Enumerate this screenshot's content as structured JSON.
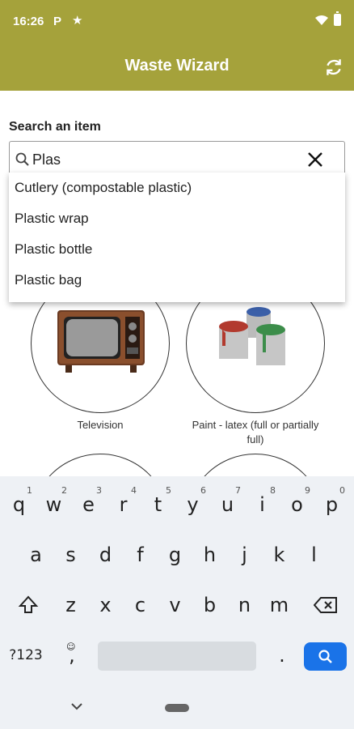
{
  "status_bar": {
    "time": "16:26",
    "notif_app": "P"
  },
  "app_bar": {
    "title": "Waste Wizard"
  },
  "search": {
    "label": "Search an item",
    "value": "Plas"
  },
  "suggestions": [
    "Cutlery (compostable plastic)",
    "Plastic wrap",
    "Plastic bottle",
    "Plastic bag"
  ],
  "items": [
    {
      "label": "Television"
    },
    {
      "label": "Paint - latex (full or partially full)"
    }
  ],
  "keyboard": {
    "row1": [
      {
        "key": "q",
        "hint": "1"
      },
      {
        "key": "w",
        "hint": "2"
      },
      {
        "key": "e",
        "hint": "3"
      },
      {
        "key": "r",
        "hint": "4"
      },
      {
        "key": "t",
        "hint": "5"
      },
      {
        "key": "y",
        "hint": "6"
      },
      {
        "key": "u",
        "hint": "7"
      },
      {
        "key": "i",
        "hint": "8"
      },
      {
        "key": "o",
        "hint": "9"
      },
      {
        "key": "p",
        "hint": "0"
      }
    ],
    "row2": [
      "a",
      "s",
      "d",
      "f",
      "g",
      "h",
      "j",
      "k",
      "l"
    ],
    "row3": [
      "z",
      "x",
      "c",
      "v",
      "b",
      "n",
      "m"
    ],
    "symbols_label": "?123",
    "comma": ",",
    "period": "."
  },
  "colors": {
    "app_bar": "#a5a23b",
    "search_key": "#1a73e8"
  }
}
